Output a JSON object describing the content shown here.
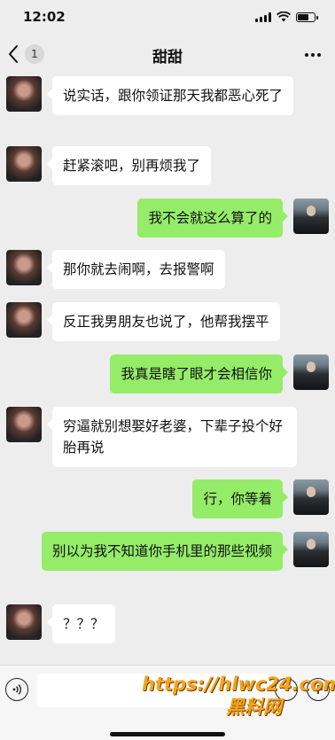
{
  "status": {
    "time": "12:02"
  },
  "header": {
    "back_badge": "1",
    "title": "甜甜"
  },
  "messages": [
    {
      "side": "left",
      "text": "说实话，跟你领证那天我都恶心死了"
    },
    {
      "side": "left",
      "text": "赶紧滚吧，别再烦我了"
    },
    {
      "side": "right",
      "text": "我不会就这么算了的"
    },
    {
      "side": "left",
      "text": "那你就去闹啊，去报警啊"
    },
    {
      "side": "left",
      "text": "反正我男朋友也说了，他帮我摆平"
    },
    {
      "side": "right",
      "text": "我真是瞎了眼才会相信你"
    },
    {
      "side": "left",
      "text": "穷逼就别想娶好老婆，下辈子投个好胎再说"
    },
    {
      "side": "right",
      "text": "行，你等着"
    },
    {
      "side": "right",
      "text": "别以为我不知道你手机里的那些视频"
    },
    {
      "side": "left",
      "text": "？？？"
    }
  ],
  "watermark": {
    "url": "https://hlwc24.com",
    "name": "黑料网"
  },
  "colors": {
    "background": "#ededed",
    "sent_bubble": "#95ec69",
    "received_bubble": "#ffffff",
    "watermark": "#f3a51f"
  },
  "icons": [
    "signal-icon",
    "wifi-icon",
    "battery-icon",
    "back-chevron-icon",
    "more-icon",
    "voice-icon",
    "emoji-icon",
    "plus-icon"
  ]
}
